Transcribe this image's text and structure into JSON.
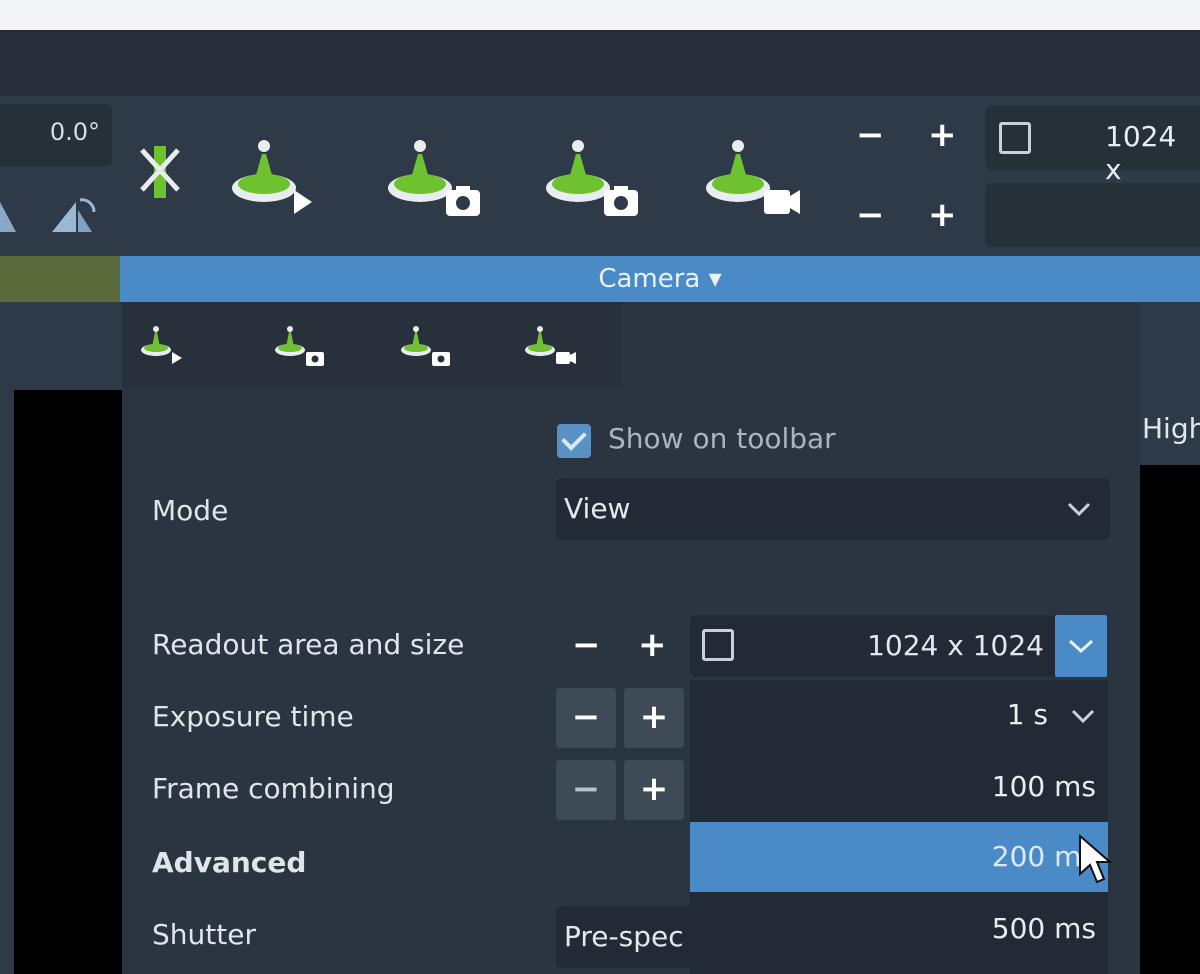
{
  "toolbar": {
    "angle_value": "0.0°",
    "minus": "−",
    "plus": "+",
    "readout_value": "1024 x",
    "tool_icons": [
      "cross-x-icon",
      "view-beam-icon",
      "camera-beam-icon",
      "camera-beam-icon-2",
      "video-beam-icon"
    ]
  },
  "camera_bar": {
    "label": "Camera ▾"
  },
  "right_edge": {
    "label": "High"
  },
  "popup": {
    "tabs": [
      "view-beam-icon",
      "camera-beam-icon",
      "camera-beam-icon-2",
      "video-beam-icon"
    ],
    "show_on_toolbar": "Show on toolbar",
    "mode_label": "Mode",
    "mode_value": "View",
    "readout_label": "Readout area and size",
    "readout_value": "1024 x 1024",
    "exposure_label": "Exposure time",
    "exposure_value": "1 s",
    "frame_label": "Frame combining",
    "advanced_label": "Advanced",
    "shutter_label": "Shutter",
    "shutter_value": "Pre-spec",
    "dropdown_options": [
      "100 ms",
      "200 ms",
      "500 ms"
    ],
    "selected_option": "200 ms"
  },
  "colors": {
    "accent": "#4a8bc7",
    "green_icon": "#6fc22f",
    "background": "#2f3a48"
  }
}
